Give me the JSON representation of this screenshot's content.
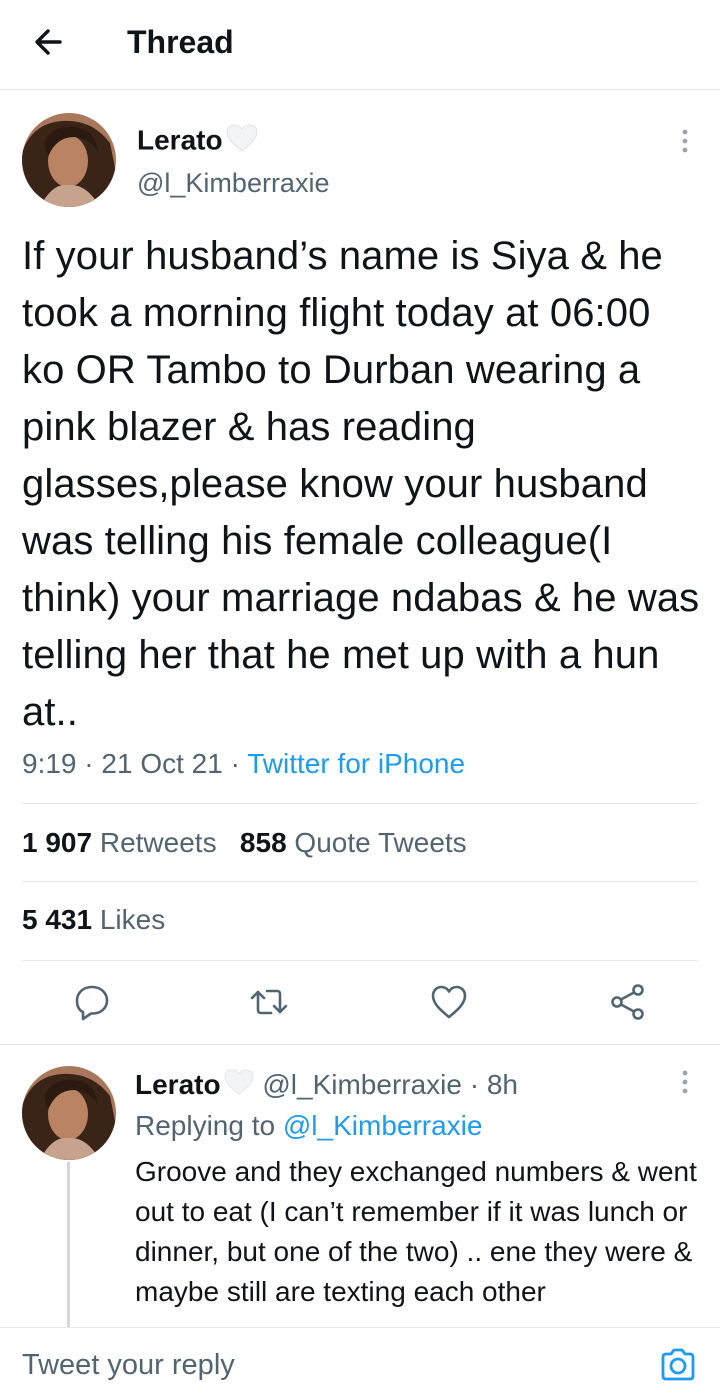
{
  "header": {
    "title": "Thread",
    "back_icon": "arrow-left-icon"
  },
  "tweet": {
    "author_name": "Lerato",
    "badge_icon": "white-heart-icon",
    "handle": "@l_Kimberraxie",
    "text": "If your husband’s name is Siya & he took a morning flight today at 06:00 ko OR Tambo to Durban wearing a pink blazer & has reading glasses,please know your husband was telling his female colleague(I think) your marriage ndabas & he was telling her that he met up with a hun at..",
    "time": "9:19",
    "date": "21 Oct 21",
    "separator": "·",
    "source": "Twitter for iPhone",
    "retweets_count": "1 907",
    "retweets_label": "Retweets",
    "quotes_count": "858",
    "quotes_label": "Quote Tweets",
    "likes_count": "5 431",
    "likes_label": "Likes"
  },
  "reply": {
    "author_name": "Lerato",
    "handle": "@l_Kimberraxie",
    "separator": "·",
    "age": "8h",
    "replying_label": "Replying to",
    "replying_to": "@l_Kimberraxie",
    "text": "Groove and they exchanged numbers & went out to eat (I can’t remember if it was lunch or dinner, but one of the two) .. ene they were & maybe still are texting each other"
  },
  "composer": {
    "placeholder": "Tweet your reply",
    "camera_icon": "camera-icon"
  },
  "colors": {
    "accent": "#1d9bf0",
    "text": "#0f1419",
    "muted": "#536471",
    "divider": "#e6e8ea"
  }
}
